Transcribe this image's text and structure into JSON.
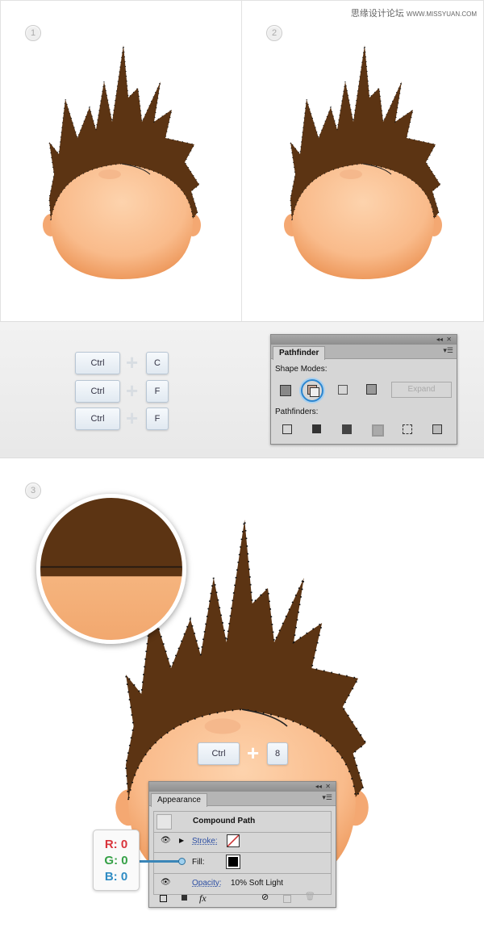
{
  "watermark": {
    "cn": "思缘设计论坛",
    "url": "WWW.MISSYUAN.COM"
  },
  "steps": [
    "1",
    "2",
    "3"
  ],
  "colors": {
    "hair": "#5c3413",
    "face": "#fbc295",
    "selection": "#0a1020",
    "r": "#d9343c",
    "g": "#35a046",
    "b": "#2f8cc4"
  },
  "shortcuts1": [
    {
      "mod": "Ctrl",
      "key": "C"
    },
    {
      "mod": "Ctrl",
      "key": "F"
    },
    {
      "mod": "Ctrl",
      "key": "F"
    }
  ],
  "shortcut3": {
    "mod": "Ctrl",
    "key": "8"
  },
  "pathfinder": {
    "title": "Pathfinder",
    "shape_modes_label": "Shape Modes:",
    "shape_modes": [
      "unite-icon",
      "minus-front-icon",
      "intersect-icon",
      "exclude-icon"
    ],
    "selected_mode": "minus-front-icon",
    "expand_label": "Expand",
    "pathfinders_label": "Pathfinders:",
    "pathfinders": [
      "divide-icon",
      "trim-icon",
      "merge-icon",
      "crop-icon",
      "outline-icon",
      "minus-back-icon"
    ]
  },
  "appearance": {
    "title": "Appearance",
    "object": "Compound Path",
    "stroke_label": "Stroke:",
    "fill_label": "Fill:",
    "opacity_label": "Opacity:",
    "opacity_value": "10% Soft Light"
  },
  "rgb": {
    "r": "R: 0",
    "g": "G: 0",
    "b": "B: 0"
  }
}
